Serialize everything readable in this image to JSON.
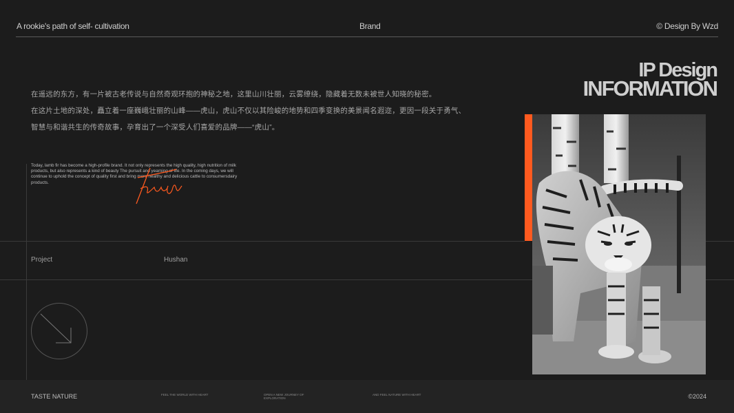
{
  "header": {
    "left_text": "A rookie's path of self- cultivation",
    "center_text": "Brand",
    "right_text": "© Design By Wzd"
  },
  "title": {
    "line1": "IP Design",
    "line2": "INFORMATION"
  },
  "intro_cn": [
    "在遥远的东方，有一片被古老传说与自然奇观环抱的神秘之地，这里山川壮丽，云雾缭绕，隐藏着无数未被世人知晓的秘密。",
    "在这片土地的深处，矗立着一座巍峨壮丽的山峰——虎山，虎山不仅以其险峻的地势和四季变换的美景闻名遐迩，更因一段关于勇气、",
    "智慧与和谐共生的传奇故事，孕育出了一个深受人们喜爱的品牌——“虎山”。"
  ],
  "intro_en": "Today, lamb fir has become a high-profile brand. It not only represents the high quality, high nutrition of milk products, but also represents a kind of beauty The pursuit and yearning of life. In the coming days, we will continue to uphold the concept of quality first and bring more healthy and delicious cattle to consumersdairy products.",
  "signature": "Fresh",
  "project": {
    "label": "Project",
    "value": "Hushan"
  },
  "footer": {
    "brand": "TASTE NATURE",
    "tag1": "FEEL THE WORLD WITH HEART",
    "tag2": "OPEN A NEW JOURNEY OF EXPLORATION",
    "tag3": "AND FEEL NATURE WITH HEART",
    "year": "©2024"
  },
  "icons": {
    "arrow": "arrow-down-right-icon",
    "photo": "tiger-photo"
  },
  "colors": {
    "accent": "#ff5a1f",
    "background": "#1c1c1c",
    "footer": "#232323"
  }
}
